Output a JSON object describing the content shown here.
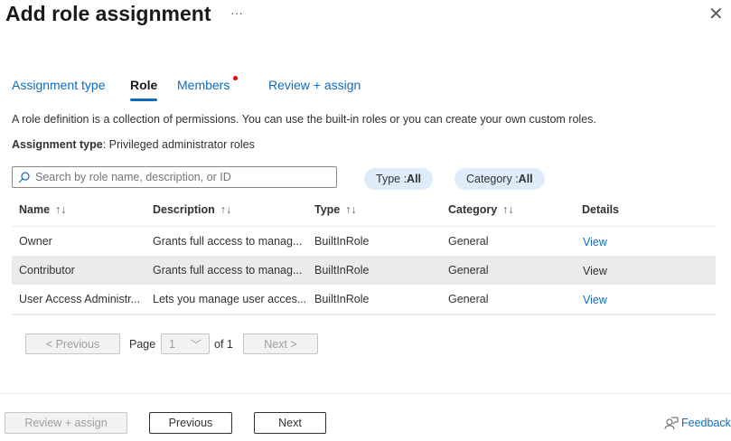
{
  "header": {
    "title": "Add role assignment",
    "more": "···",
    "close": "✕"
  },
  "tabs": [
    {
      "label": "Assignment type"
    },
    {
      "label": "Role"
    },
    {
      "label": "Members"
    },
    {
      "label": "Review + assign"
    }
  ],
  "description": "A role definition is a collection of permissions. You can use the built-in roles or you can create your own custom roles.",
  "assignment_type": {
    "label": "Assignment type",
    "value": ": Privileged administrator roles"
  },
  "search": {
    "placeholder": "Search by role name, description, or ID",
    "value": ""
  },
  "filters": [
    {
      "label": "Type : ",
      "value": "All"
    },
    {
      "label": "Category : ",
      "value": "All"
    }
  ],
  "table": {
    "columns": [
      "Name",
      "Description",
      "Type",
      "Category",
      "Details"
    ],
    "sort_icon": "↑↓",
    "rows": [
      {
        "name": "Owner",
        "description": "Grants full access to manag...",
        "type": "BuiltInRole",
        "category": "General",
        "details": "View"
      },
      {
        "name": "Contributor",
        "description": "Grants full access to manag...",
        "type": "BuiltInRole",
        "category": "General",
        "details": "View"
      },
      {
        "name": "User Access Administr...",
        "description": "Lets you manage user acces...",
        "type": "BuiltInRole",
        "category": "General",
        "details": "View"
      }
    ]
  },
  "pagination": {
    "previous": "< Previous",
    "page_label": "Page",
    "page": "1",
    "of": "of 1",
    "next": "Next >"
  },
  "footer": {
    "review": "Review + assign",
    "previous": "Previous",
    "next": "Next",
    "feedback": "Feedback"
  }
}
